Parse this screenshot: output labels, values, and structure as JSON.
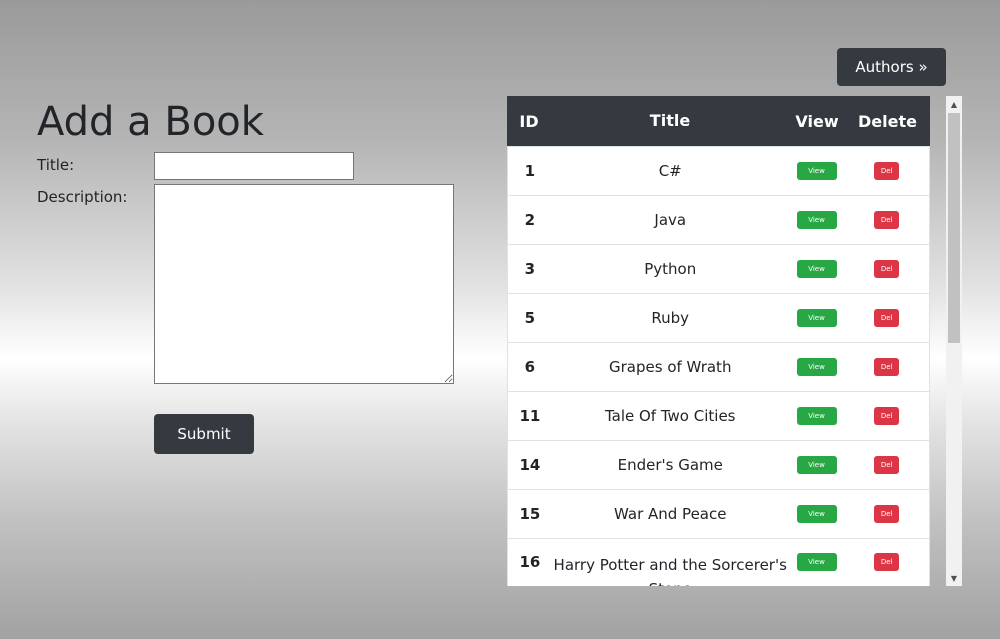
{
  "nav": {
    "authors_label": "Authors »"
  },
  "form": {
    "heading": "Add a Book",
    "title_label": "Title:",
    "title_value": "",
    "description_label": "Description:",
    "description_value": "",
    "submit_label": "Submit"
  },
  "table": {
    "headers": {
      "id": "ID",
      "title": "Title",
      "view": "View",
      "delete": "Delete"
    },
    "view_label": "View",
    "delete_label": "Del",
    "rows": [
      {
        "id": "1",
        "title": "C#"
      },
      {
        "id": "2",
        "title": "Java"
      },
      {
        "id": "3",
        "title": "Python"
      },
      {
        "id": "5",
        "title": "Ruby"
      },
      {
        "id": "6",
        "title": "Grapes of Wrath"
      },
      {
        "id": "11",
        "title": "Tale Of Two Cities"
      },
      {
        "id": "14",
        "title": "Ender's Game"
      },
      {
        "id": "15",
        "title": "War And Peace"
      },
      {
        "id": "16",
        "title": "Harry Potter and the Sorcerer's Stone"
      }
    ]
  },
  "colors": {
    "dark": "#343a40",
    "view_green": "#28a745",
    "delete_red": "#dc3545"
  },
  "icons": {
    "scroll_up": "scroll-up-arrow-icon",
    "scroll_down": "scroll-down-arrow-icon"
  }
}
